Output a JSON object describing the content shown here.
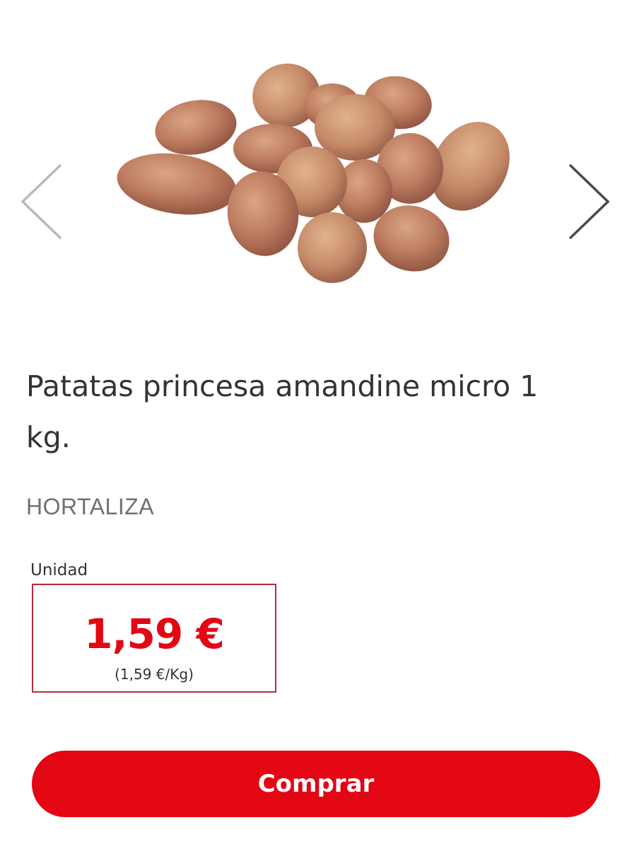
{
  "carousel": {
    "prev_icon": "chevron-left-icon",
    "next_icon": "chevron-right-icon",
    "image_subject": "potatoes"
  },
  "product": {
    "title": "Patatas princesa amandine micro 1 kg.",
    "category": "HORTALIZA"
  },
  "pricing": {
    "unit_label": "Unidad",
    "price": "1,59 €",
    "price_per_kg": "(1,59 €/Kg)"
  },
  "actions": {
    "buy_label": "Comprar"
  },
  "colors": {
    "accent": "#e30613",
    "price_border": "#b72a37",
    "text": "#333333",
    "category": "#6e7077"
  }
}
